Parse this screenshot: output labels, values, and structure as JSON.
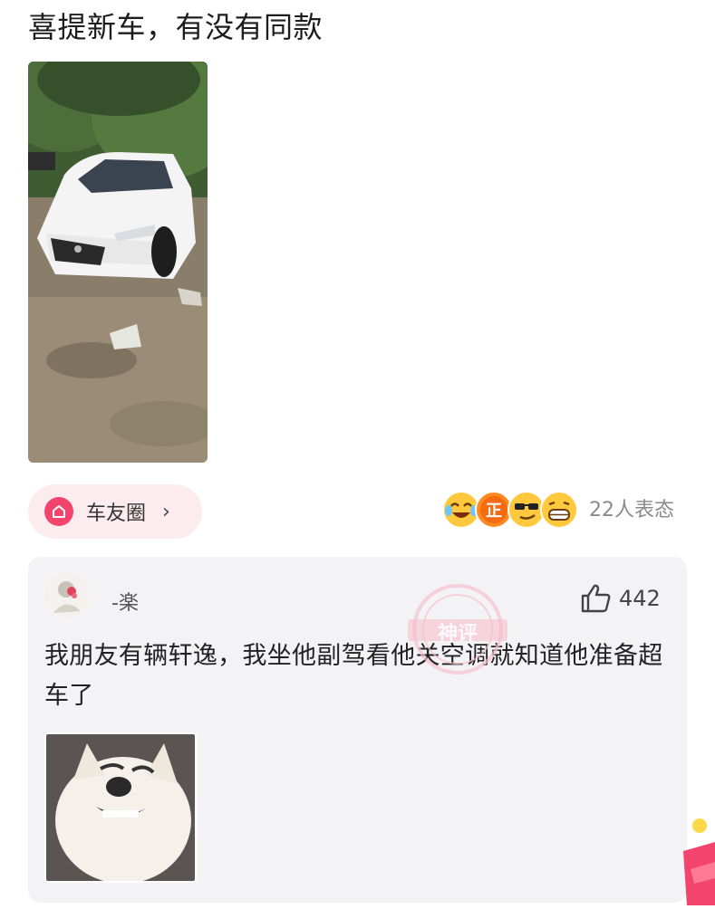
{
  "post": {
    "title": "喜提新车，有没有同款"
  },
  "tag": {
    "label": "车友圈",
    "chevron": "›"
  },
  "reactions": {
    "count_text": "22人表态",
    "emojis": [
      "laughing-cry-emoji",
      "zheng-badge-emoji",
      "sunglasses-emoji",
      "grin-emoji"
    ],
    "badge_char": "正"
  },
  "comment": {
    "username": "-楽",
    "like_count": "442",
    "text": "我朋友有辆轩逸，我坐他副驾看他关空调就知道他准备超车了"
  },
  "watermark": {
    "text": "神评"
  },
  "colors": {
    "accent_pink": "#f2446d",
    "pill_bg": "#fdecef",
    "card_bg": "#f3f3f6",
    "muted_text": "#8b8b8b"
  }
}
